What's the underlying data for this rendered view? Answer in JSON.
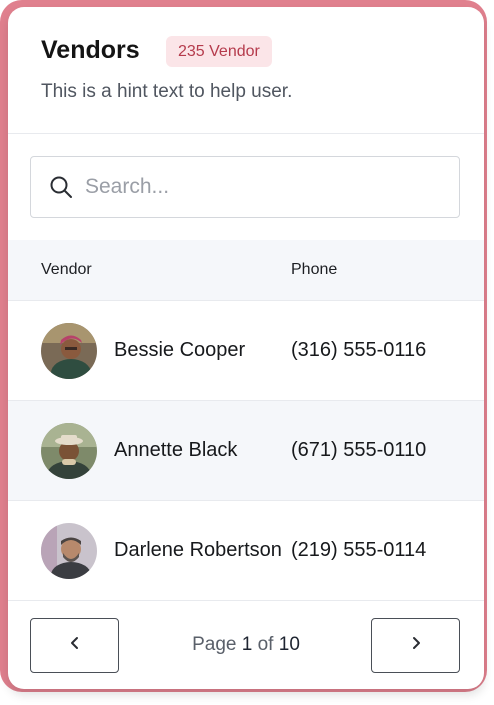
{
  "header": {
    "title": "Vendors",
    "badge": "235 Vendor",
    "hint": "This is a hint text to help user."
  },
  "search": {
    "placeholder": "Search...",
    "value": ""
  },
  "table": {
    "columns": [
      "Vendor",
      "Phone"
    ],
    "rows": [
      {
        "name": "Bessie Cooper",
        "phone": "(316) 555-0116"
      },
      {
        "name": "Annette Black",
        "phone": "(671) 555-0110"
      },
      {
        "name": "Darlene Robertson",
        "phone": "(219) 555-0114"
      }
    ]
  },
  "pagination": {
    "prefix": "Page",
    "current": "1",
    "separator": "of",
    "total": "10",
    "prev_icon": "chevron-left-icon",
    "next_icon": "chevron-right-icon"
  },
  "colors": {
    "badge_bg": "#fbe5e8",
    "badge_text": "#b53b4c",
    "frame": "#e0808e"
  }
}
